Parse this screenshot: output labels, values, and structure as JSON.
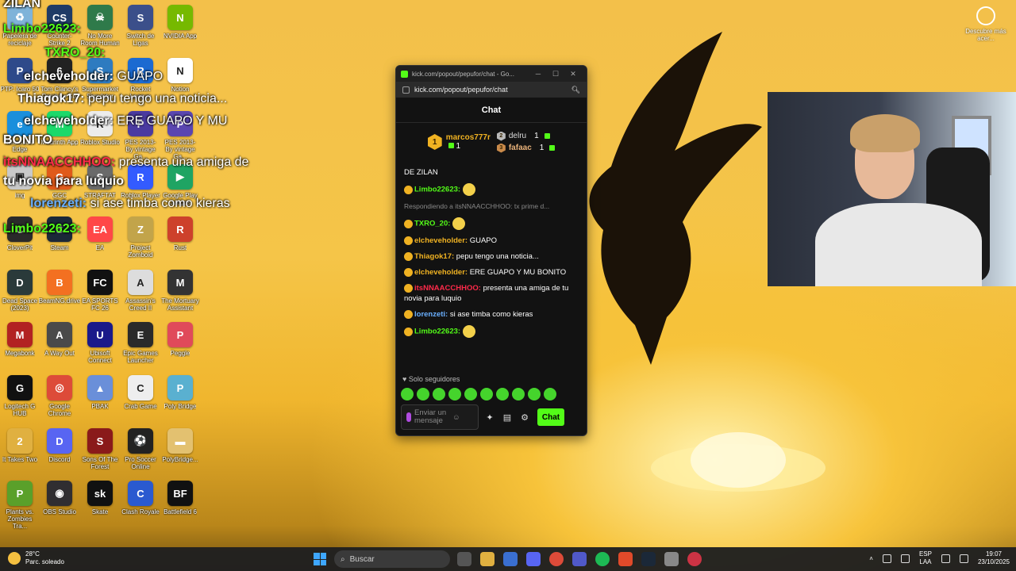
{
  "desktop": {
    "icons": [
      {
        "label": "Papelera de reciclaje",
        "color": "#7fb3d9",
        "glyph": "♻"
      },
      {
        "label": "Counter-Strike 2",
        "color": "#1f3b66",
        "glyph": "CS"
      },
      {
        "label": "No More Room Human",
        "color": "#2f7a4a",
        "glyph": "☠"
      },
      {
        "label": "Switch de Ligas",
        "color": "#3b4f8a",
        "glyph": "S"
      },
      {
        "label": "NVIDIA App",
        "color": "#76b900",
        "glyph": "N"
      },
      {
        "label": "PTP: Icaro 50",
        "color": "#2e4a8a",
        "glyph": "P"
      },
      {
        "label": "Tom Clancy's Rainbow Six",
        "color": "#222",
        "glyph": "6"
      },
      {
        "label": "Supermarket Simulator",
        "color": "#2e7bc0",
        "glyph": "S"
      },
      {
        "label": "Rocket League",
        "color": "#1b6ad1",
        "glyph": "R"
      },
      {
        "label": "Notion",
        "color": "#fff",
        "glyph": "N"
      },
      {
        "label": "Microsoft Edge",
        "color": "#1a8fdc",
        "glyph": "e"
      },
      {
        "label": "Modrinth App",
        "color": "#1bd96a",
        "glyph": "M"
      },
      {
        "label": "Roblox Studio",
        "color": "#ececec",
        "glyph": "R"
      },
      {
        "label": "PES 2013- By vintage Ga...",
        "color": "#4a3aa0",
        "glyph": "P"
      },
      {
        "label": "PES 2013- By vintage Ga...",
        "color": "#5a46b0",
        "glyph": "P"
      },
      {
        "label": "img",
        "color": "#c9c9c9",
        "glyph": "▣"
      },
      {
        "label": "GGC",
        "color": "#e05a1a",
        "glyph": "G"
      },
      {
        "label": "STRAFTAT",
        "color": "#6a6a6a",
        "glyph": "S"
      },
      {
        "label": "Roblox Player",
        "color": "#335bff",
        "glyph": "R"
      },
      {
        "label": "Google Play Juegos",
        "color": "#1fa463",
        "glyph": "▶"
      },
      {
        "label": "CloverPit",
        "color": "#2a2a2a",
        "glyph": "C"
      },
      {
        "label": "Steam",
        "color": "#1b2838",
        "glyph": "S"
      },
      {
        "label": "EA",
        "color": "#ff4747",
        "glyph": "EA"
      },
      {
        "label": "Project Zomboid",
        "color": "#c2a44a",
        "glyph": "Z"
      },
      {
        "label": "Rust",
        "color": "#cd412b",
        "glyph": "R"
      },
      {
        "label": "Dead Space (2023)",
        "color": "#2a3a3a",
        "glyph": "D"
      },
      {
        "label": "BeamNG.drive",
        "color": "#f37021",
        "glyph": "B"
      },
      {
        "label": "EA SPORTS FC 26",
        "color": "#111",
        "glyph": "FC"
      },
      {
        "label": "Assassin's Creed II",
        "color": "#ddd",
        "glyph": "A"
      },
      {
        "label": "The Mortuary Assistant",
        "color": "#333",
        "glyph": "M"
      },
      {
        "label": "Megabonk",
        "color": "#b22222",
        "glyph": "M"
      },
      {
        "label": "A Way Out",
        "color": "#4a4a4a",
        "glyph": "A"
      },
      {
        "label": "Ubisoft Connect",
        "color": "#1a1a8a",
        "glyph": "U"
      },
      {
        "label": "Epic Games Launcher",
        "color": "#2a2a2a",
        "glyph": "E"
      },
      {
        "label": "Peggle",
        "color": "#e04a5a",
        "glyph": "P"
      },
      {
        "label": "Logitech G HUB",
        "color": "#111",
        "glyph": "G"
      },
      {
        "label": "Google Chrome",
        "color": "#dd4b39",
        "glyph": "◎"
      },
      {
        "label": "PBAK",
        "color": "#6a8fd9",
        "glyph": "▲"
      },
      {
        "label": "Crab Game",
        "color": "#eee",
        "glyph": "C"
      },
      {
        "label": "Poly Bridge",
        "color": "#5ab0d0",
        "glyph": "P"
      },
      {
        "label": "It Takes Two",
        "color": "#e0b040",
        "glyph": "2"
      },
      {
        "label": "Discord",
        "color": "#5865f2",
        "glyph": "D"
      },
      {
        "label": "Sons Of The Forest",
        "color": "#8a1a1a",
        "glyph": "S"
      },
      {
        "label": "Pro Soccer Online",
        "color": "#222",
        "glyph": "⚽"
      },
      {
        "label": "PolyBridge...",
        "color": "#e3c170",
        "glyph": "▬"
      },
      {
        "label": "Plants vs. Zombies Tra...",
        "color": "#5aa02a",
        "glyph": "P"
      },
      {
        "label": "OBS Studio",
        "color": "#302e31",
        "glyph": "◉"
      },
      {
        "label": "Skate",
        "color": "#111",
        "glyph": "sk"
      },
      {
        "label": "Clash Royale",
        "color": "#2a5ad0",
        "glyph": "C"
      },
      {
        "label": "Battlefield 6",
        "color": "#111",
        "glyph": "BF"
      }
    ]
  },
  "overlay": {
    "lines": [
      {
        "user": "ZILAN",
        "text": "",
        "color": "#ffffff"
      },
      {
        "user": "Limbo22623:",
        "text": "",
        "color": "#53fc18"
      },
      {
        "user": "TXRO_20:",
        "text": "",
        "color": "#53fc18"
      },
      {
        "user": "elcheveholder:",
        "text": "GUAPO",
        "color": "#ffffff"
      },
      {
        "user": "Thiagok17:",
        "text": "pepu tengo una noticia...",
        "color": "#ffffff"
      },
      {
        "user": "elcheveholder:",
        "text": "ERE GUAPO Y MU",
        "color": "#ffffff"
      },
      {
        "user": "BONITO",
        "text": "",
        "color": "#ffffff"
      },
      {
        "user": "itsNNAACCHHOO:",
        "text": "presenta una amiga de",
        "color": "#ff2a4a"
      },
      {
        "user": "tu novia para luquio",
        "text": "",
        "color": "#ffffff"
      },
      {
        "user": "lorenzeti:",
        "text": "si ase timba como kieras",
        "color": "#6ab0ff"
      },
      {
        "user": "Limbo22623:",
        "text": "",
        "color": "#53fc18"
      }
    ]
  },
  "browser": {
    "window_title": "kick.com/popout/pepufor/chat - Go...",
    "url": "kick.com/popout/pepufor/chat"
  },
  "chat": {
    "header": "Chat",
    "leaderboard": {
      "first": {
        "rank": "1",
        "name": "marcos777r",
        "count": "1"
      },
      "second": {
        "rank": "2",
        "name": "delru",
        "count": "1"
      },
      "third": {
        "rank": "3",
        "name": "fafaac",
        "count": "1"
      }
    },
    "messages": [
      {
        "user": "",
        "text": "DE ZILAN",
        "color": "#ffffff"
      },
      {
        "user": "Limbo22623:",
        "text": "",
        "color": "#53fc18"
      },
      {
        "user": "",
        "text": "Respondiendo a itsNNAACCHHOO: tx prime d...",
        "color": "#888888"
      },
      {
        "user": "TXRO_20:",
        "text": "",
        "color": "#53fc18"
      },
      {
        "user": "elcheveholder:",
        "text": "GUAPO",
        "color": "#f0b222"
      },
      {
        "user": "Thiagok17:",
        "text": "pepu tengo una noticia...",
        "color": "#f0b222"
      },
      {
        "user": "elcheveholder:",
        "text": "ERE GUAPO Y MU BONITO",
        "color": "#f0b222"
      },
      {
        "user": "itsNNAACCHHOO:",
        "text": "presenta una amiga de tu novia para luquio",
        "color": "#ff2a4a"
      },
      {
        "user": "lorenzeti:",
        "text": "si ase timba como kieras",
        "color": "#6ab0ff"
      },
      {
        "user": "Limbo22623:",
        "text": "",
        "color": "#53fc18"
      }
    ],
    "followers_only": "Solo seguidores",
    "input_placeholder": "Enviar un mensaje",
    "send_label": "Chat"
  },
  "discover": {
    "label": "Descubre más acer..."
  },
  "taskbar": {
    "weather_temp": "28°C",
    "weather_desc": "Parc. soleado",
    "search_placeholder": "Buscar",
    "lang_top": "ESP",
    "lang_bottom": "LAA",
    "time": "19:07",
    "date": "23/10/2025"
  },
  "colors": {
    "kick_green": "#53fc18",
    "gold": "#f0b222"
  }
}
